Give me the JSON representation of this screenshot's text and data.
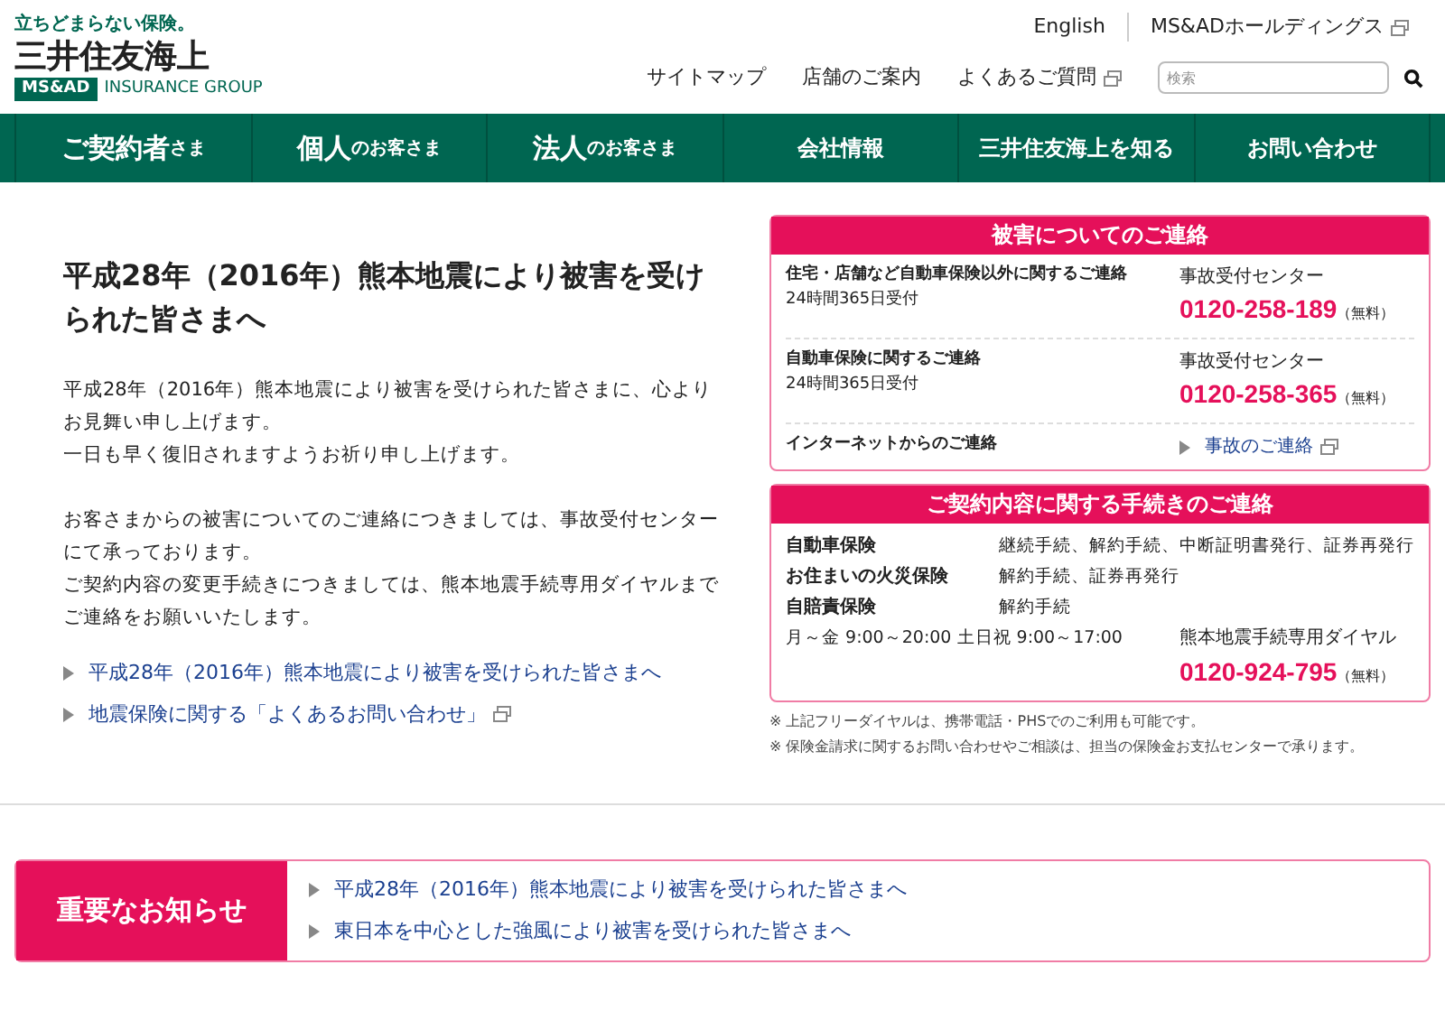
{
  "header": {
    "tagline": "立ちどまらない保険。",
    "logo": "三井住友海上",
    "group_badge": "MS&AD",
    "group_text": "INSURANCE GROUP",
    "top_links": [
      {
        "label": "English",
        "external": false
      },
      {
        "label": "MS&ADホールディングス",
        "external": true
      }
    ],
    "links": [
      {
        "label": "サイトマップ",
        "external": false
      },
      {
        "label": "店舗のご案内",
        "external": false
      },
      {
        "label": "よくあるご質問",
        "external": true
      }
    ],
    "search": {
      "placeholder": "検索"
    }
  },
  "nav": [
    {
      "main": "ご契約者",
      "suffix": "さま",
      "kind": "large"
    },
    {
      "main": "個人",
      "suffix": "のお客さま",
      "kind": "large"
    },
    {
      "main": "法人",
      "suffix": "のお客さま",
      "kind": "large"
    },
    {
      "main": "会社情報",
      "kind": "small"
    },
    {
      "main": "三井住友海上を知る",
      "kind": "small"
    },
    {
      "main": "お問い合わせ",
      "kind": "small"
    }
  ],
  "article": {
    "title": "平成28年（2016年）熊本地震により被害を受けられた皆さまへ",
    "paragraphs": [
      [
        "平成28年（2016年）熊本地震により被害を受けられた皆さまに、心よりお見舞い申し上げます。",
        "一日も早く復旧されますようお祈り申し上げます。"
      ],
      [
        "お客さまからの被害についてのご連絡につきましては、事故受付センターにて承っております。",
        "ご契約内容の変更手続きにつきましては、熊本地震手続専用ダイヤルまでご連絡をお願いいたします。"
      ]
    ],
    "links": [
      {
        "label": "平成28年（2016年）熊本地震により被害を受けられた皆さまへ",
        "external": false
      },
      {
        "label": "地震保険に関する「よくあるお問い合わせ」",
        "external": true
      }
    ]
  },
  "damage_box": {
    "title": "被害についてのご連絡",
    "rows": [
      {
        "kind": "phone",
        "label": "住宅・店舗など自動車保険以外に関するご連絡",
        "hours": "24時間365日受付",
        "center": "事故受付センター",
        "number": "0120-258-189",
        "free": "（無料）"
      },
      {
        "kind": "phone",
        "label": "自動車保険に関するご連絡",
        "hours": "24時間365日受付",
        "center": "事故受付センター",
        "number": "0120-258-365",
        "free": "（無料）"
      },
      {
        "kind": "link",
        "label": "インターネットからのご連絡",
        "link": "事故のご連絡"
      }
    ]
  },
  "procedure_box": {
    "title": "ご契約内容に関する手続きのご連絡",
    "rows": [
      {
        "label": "自動車保険",
        "value": "継続手続、解約手続、中断証明書発行、証券再発行"
      },
      {
        "label": "お住まいの火災保険",
        "value": "解約手続、証券再発行"
      },
      {
        "label": "自賠責保険",
        "value": "解約手続"
      }
    ],
    "hours": "月～金 9:00～20:00 土日祝 9:00～17:00",
    "center": "熊本地震手続専用ダイヤル",
    "number": "0120-924-795",
    "free": "（無料）"
  },
  "notes": [
    "※ 上記フリーダイヤルは、携帯電話・PHSでのご利用も可能です。",
    "※ 保険金請求に関するお問い合わせやご相談は、担当の保険金お支払センターで承ります。"
  ],
  "notice": {
    "title": "重要なお知らせ",
    "items": [
      "平成28年（2016年）熊本地震により被害を受けられた皆さまへ",
      "東日本を中心とした強風により被害を受けられた皆さまへ"
    ]
  }
}
